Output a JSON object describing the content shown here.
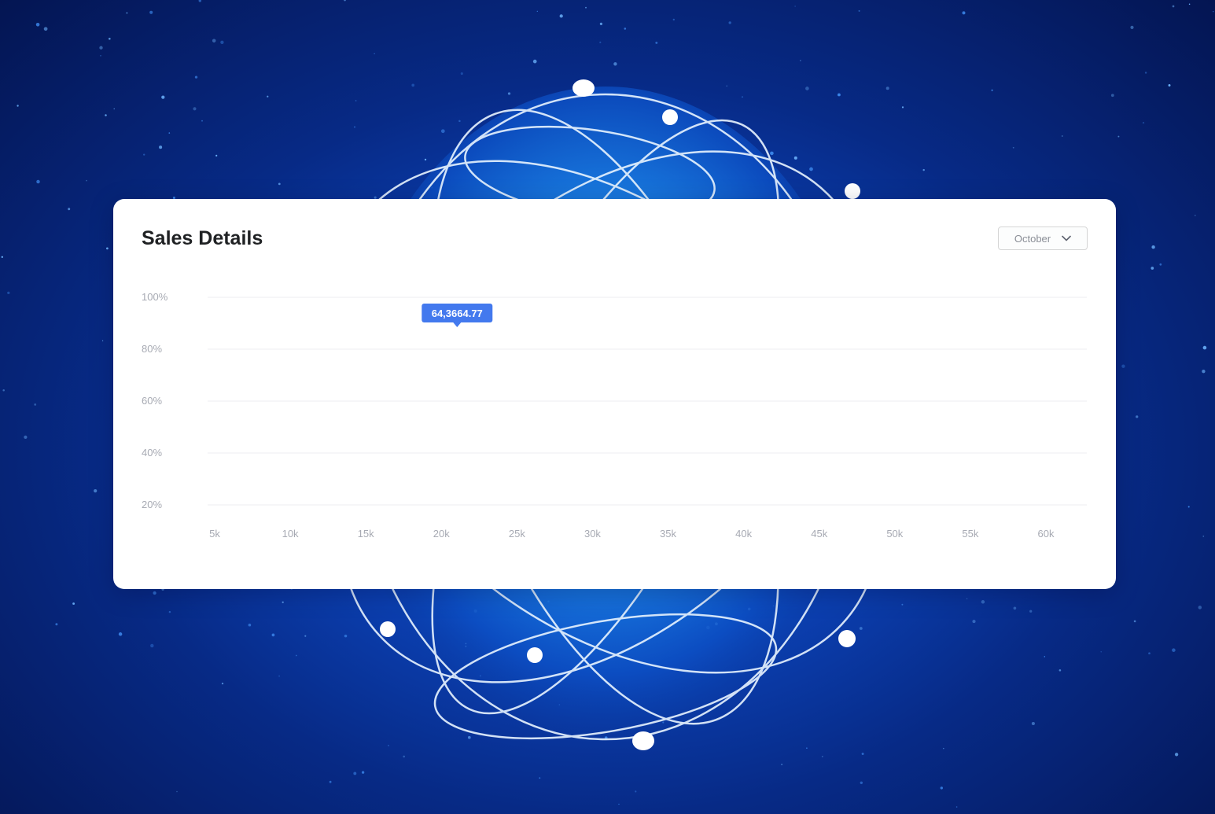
{
  "card": {
    "title": "Sales Details"
  },
  "month_select": {
    "value": "October",
    "icon": "chevron-down-icon"
  },
  "chart_data": {
    "type": "line",
    "y_ticks": [
      "20%",
      "40%",
      "60%",
      "80%",
      "100%"
    ],
    "x_ticks": [
      "5k",
      "10k",
      "15k",
      "20k",
      "25k",
      "30k",
      "35k",
      "40k",
      "45k",
      "50k",
      "55k",
      "60k"
    ],
    "tooltip": {
      "label": "64,3664.77",
      "x_category": "20k",
      "y_value": 100
    },
    "grid": true,
    "series": []
  },
  "colors": {
    "tooltip_bg": "#4379ee",
    "grid": "#eceef2",
    "tick_text": "#a7aab3",
    "title_text": "#202224"
  }
}
